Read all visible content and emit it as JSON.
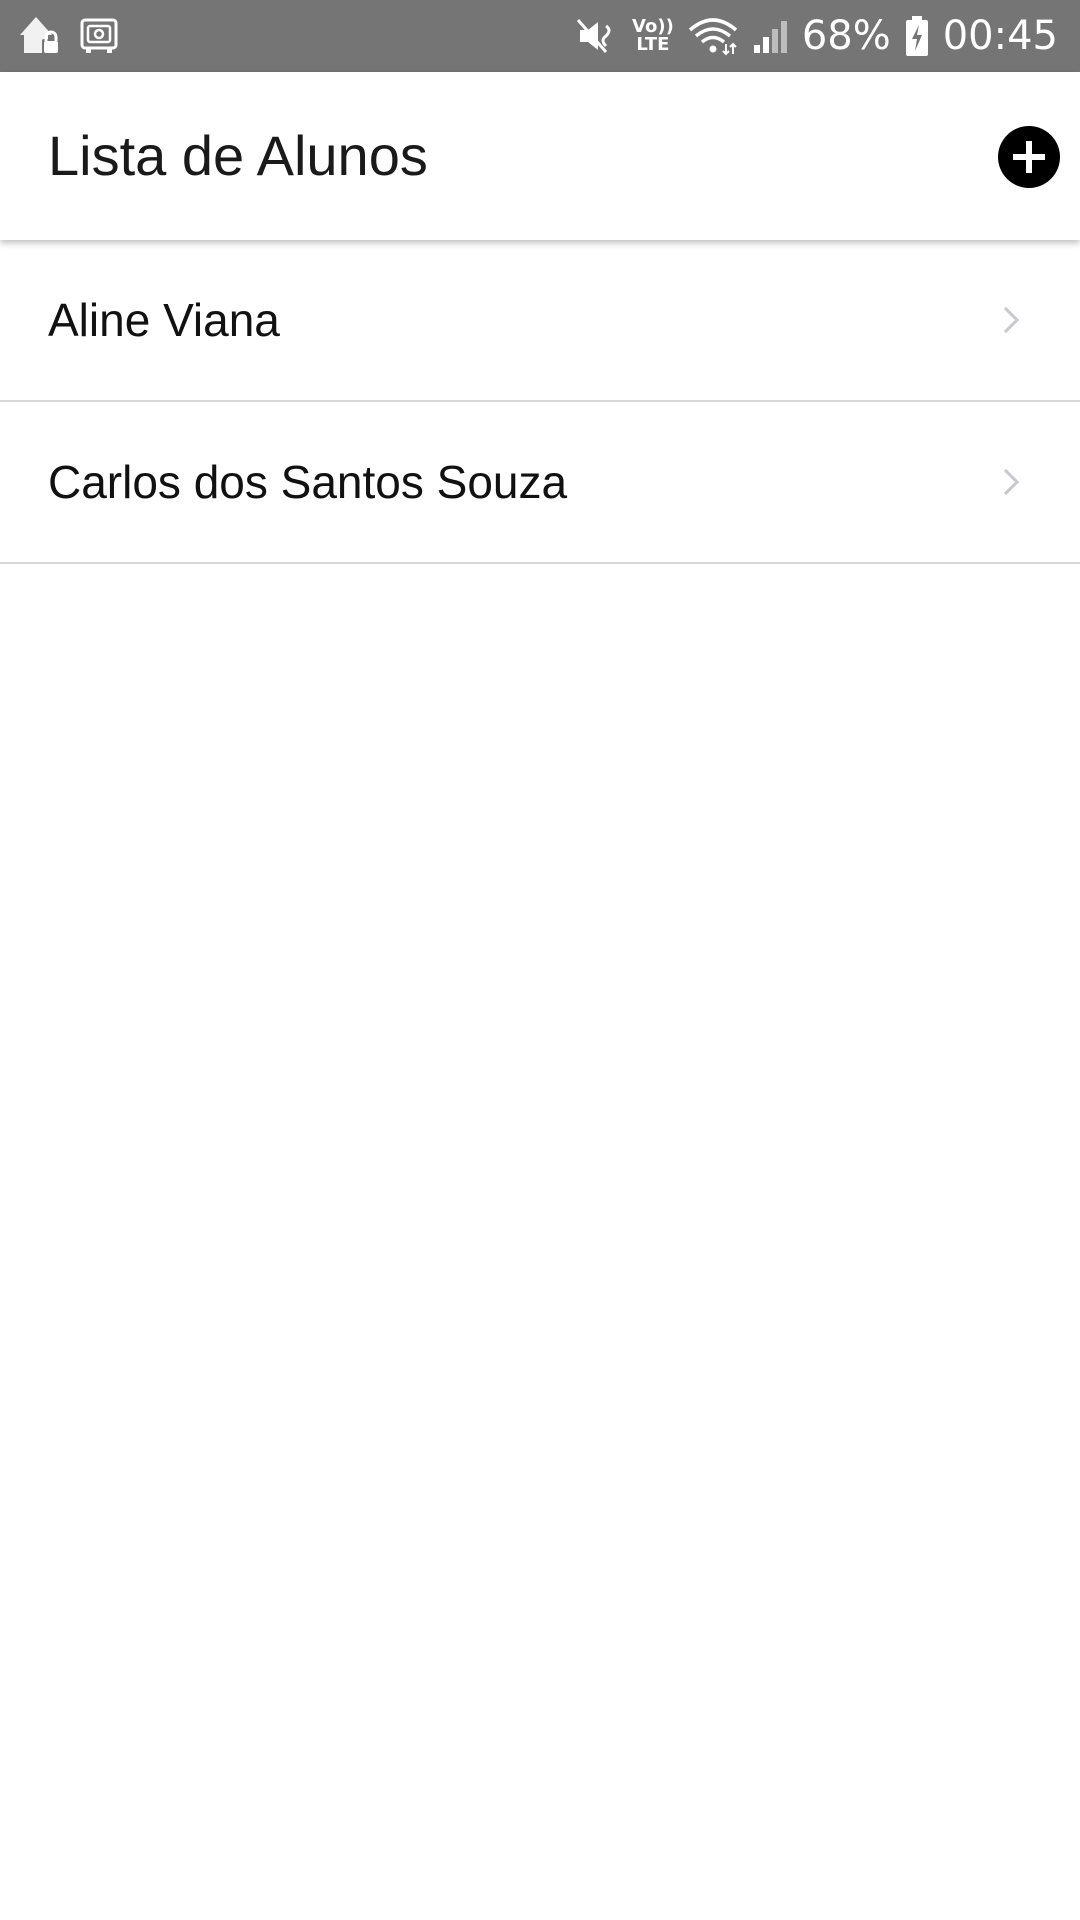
{
  "status_bar": {
    "battery_percent": "68%",
    "time": "00:45",
    "volte_top": "Vo))",
    "volte_bottom": "LTE",
    "icons": [
      "location-lock-icon",
      "safe-icon",
      "mute-icon",
      "volte-icon",
      "wifi-icon",
      "signal-icon",
      "battery-charging-icon"
    ]
  },
  "app_bar": {
    "title": "Lista de Alunos",
    "add_icon": "plus-circle-icon"
  },
  "students": [
    {
      "name": "Aline Viana"
    },
    {
      "name": "Carlos dos Santos Souza"
    }
  ],
  "colors": {
    "status_bar_bg": "#757575",
    "background": "#ffffff",
    "divider": "#d6d6d6",
    "chevron": "#c7c7cc",
    "add_button": "#000000"
  }
}
